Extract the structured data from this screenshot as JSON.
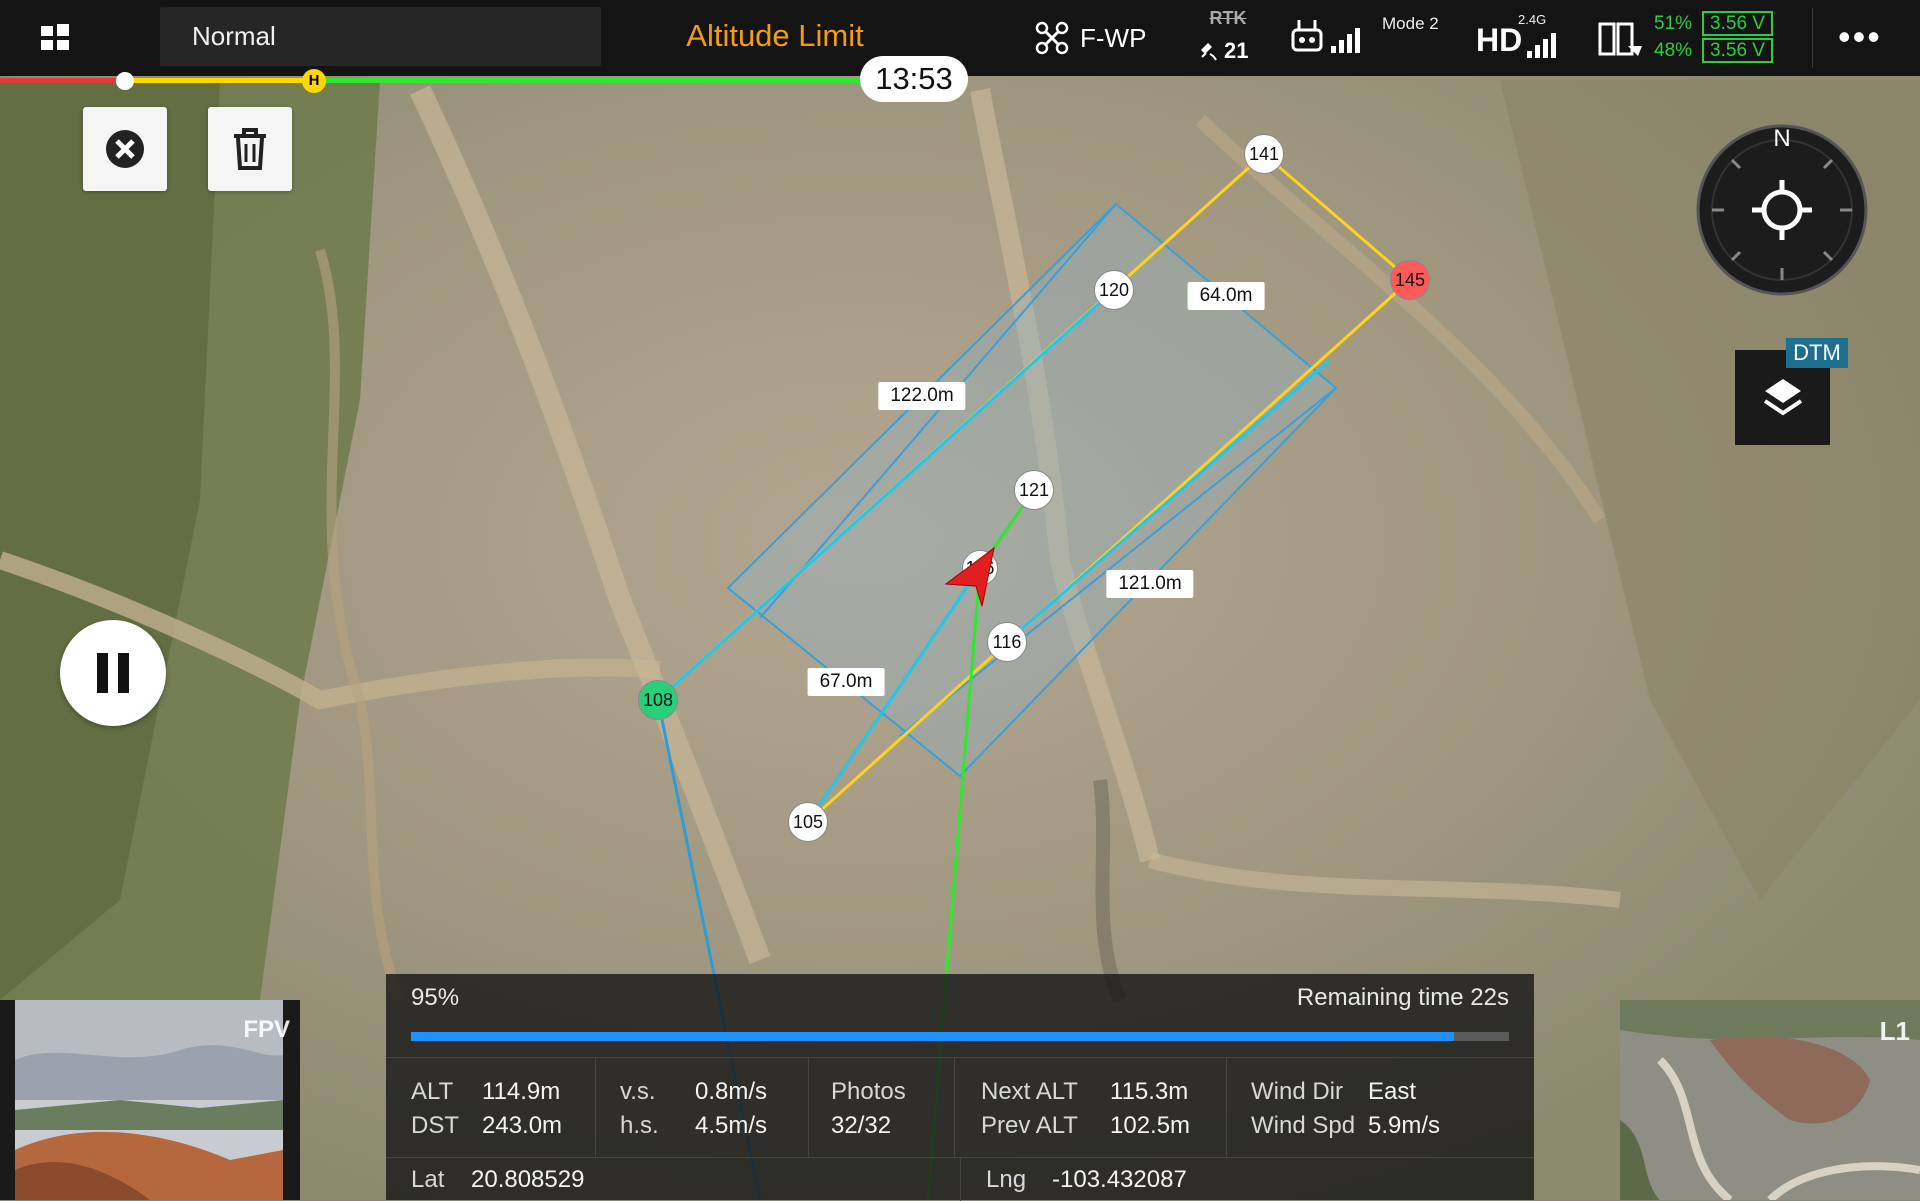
{
  "topbar": {
    "flight_mode": "Normal",
    "alert": "Altitude Limit",
    "aircraft": "F-WP",
    "rtk_label": "RTK",
    "satellites": "21",
    "rc_mode": "Mode 2",
    "hd_label": "HD",
    "hd_band": "2.4G",
    "battery1_percent": "51%",
    "battery1_voltage": "3.56 V",
    "battery2_percent": "48%",
    "battery2_voltage": "3.56 V"
  },
  "flight_timer": "13:53",
  "flight_progress_marker": "H",
  "map": {
    "layer_badge": "DTM",
    "compass_north": "N",
    "waypoints": [
      {
        "label": "141",
        "kind": "normal"
      },
      {
        "label": "145",
        "kind": "red"
      },
      {
        "label": "120",
        "kind": "normal"
      },
      {
        "label": "121",
        "kind": "normal"
      },
      {
        "label": "116",
        "kind": "normal"
      },
      {
        "label": "108",
        "kind": "green"
      },
      {
        "label": "105",
        "kind": "normal"
      },
      {
        "label": "116",
        "kind": "normal"
      }
    ],
    "distances": [
      "64.0m",
      "122.0m",
      "121.0m",
      "67.0m"
    ]
  },
  "panel": {
    "progress_text": "95%",
    "progress_value": 0.95,
    "remaining": "Remaining time 22s",
    "alt_label": "ALT",
    "alt": "114.9m",
    "dst_label": "DST",
    "dst": "243.0m",
    "vs_label": "v.s.",
    "vs": "0.8m/s",
    "hs_label": "h.s.",
    "hs": "4.5m/s",
    "photos_label": "Photos",
    "photos": "32/32",
    "next_alt_label": "Next ALT",
    "next_alt": "115.3m",
    "prev_alt_label": "Prev ALT",
    "prev_alt": "102.5m",
    "wind_dir_label": "Wind Dir",
    "wind_dir": "East",
    "wind_spd_label": "Wind Spd",
    "wind_spd": "5.9m/s",
    "lat_label": "Lat",
    "lat": "20.808529",
    "lng_label": "Lng",
    "lng": "-103.432087"
  },
  "fpv_label": "FPV",
  "l1_label": "L1",
  "colors": {
    "alert": "#f39c12",
    "battery": "#2ecc40",
    "progress": "#1e90ff",
    "route_yellow": "#ffd21e",
    "route_cyan": "#1ec8f0",
    "route_green": "#2ee82e"
  }
}
